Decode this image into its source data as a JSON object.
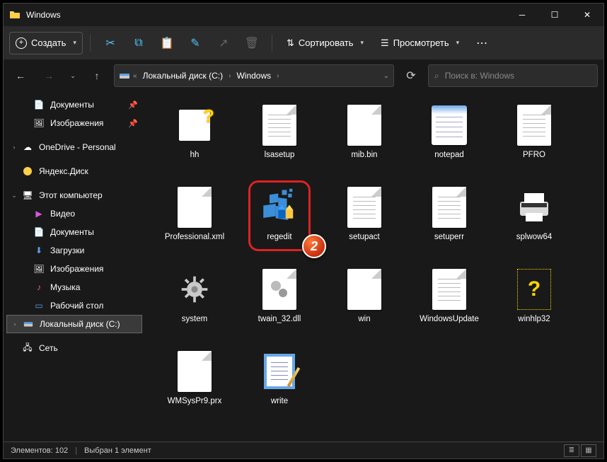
{
  "window": {
    "title": "Windows"
  },
  "toolbar": {
    "new_label": "Создать",
    "sort_label": "Сортировать",
    "view_label": "Просмотреть"
  },
  "path": {
    "seg1": "Локальный диск (C:)",
    "seg2": "Windows"
  },
  "search": {
    "placeholder": "Поиск в: Windows"
  },
  "sidebar": {
    "docs": "Документы",
    "pics": "Изображения",
    "onedrive": "OneDrive - Personal",
    "yadisk": "Яндекс.Диск",
    "thispc": "Этот компьютер",
    "video": "Видео",
    "docs2": "Документы",
    "downloads": "Загрузки",
    "pics2": "Изображения",
    "music": "Музыка",
    "desktop": "Рабочий стол",
    "cdrive": "Локальный диск (C:)",
    "network": "Сеть"
  },
  "files": {
    "r1c1": "hh",
    "r1c2": "lsasetup",
    "r1c3": "mib.bin",
    "r1c4": "notepad",
    "r1c5": "PFRO",
    "r2c1": "Professional.xml",
    "r2c2": "regedit",
    "r2c3": "setupact",
    "r2c4": "setuperr",
    "r2c5": "splwow64",
    "r3c1": "system",
    "r3c2": "twain_32.dll",
    "r3c3": "win",
    "r3c4": "WindowsUpdate",
    "r3c5": "winhlp32",
    "r4c1": "WMSysPr9.prx",
    "r4c2": "write"
  },
  "status": {
    "count": "Элементов: 102",
    "selected": "Выбран 1 элемент"
  },
  "callout": {
    "num": "2"
  }
}
